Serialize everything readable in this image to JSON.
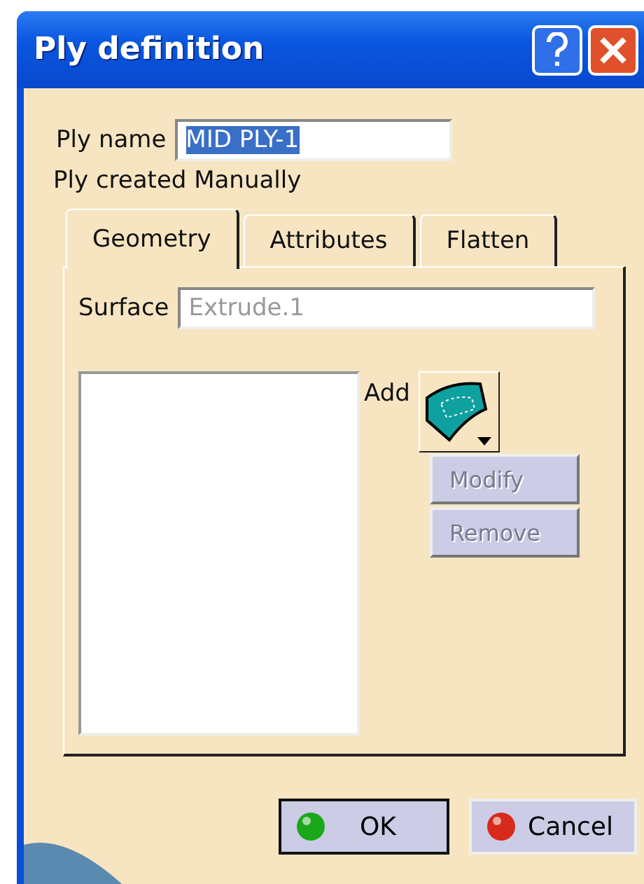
{
  "window": {
    "title": "Ply definition"
  },
  "ply_name": {
    "label": "Ply name",
    "value": "MID PLY-1",
    "text_selected": true
  },
  "creation_note": "Ply created Manually",
  "tabs": [
    {
      "label": "Geometry",
      "selected": true
    },
    {
      "label": "Attributes",
      "selected": false
    },
    {
      "label": "Flatten",
      "selected": false
    }
  ],
  "surface": {
    "label": "Surface",
    "value": "Extrude.1",
    "disabled": true
  },
  "add_label": "Add",
  "side_buttons": [
    {
      "label": "Modify",
      "disabled": true
    },
    {
      "label": "Remove",
      "disabled": true
    }
  ],
  "footer_buttons": [
    {
      "label": "OK",
      "kind": "ok"
    },
    {
      "label": "Cancel",
      "kind": "cancel"
    }
  ]
}
